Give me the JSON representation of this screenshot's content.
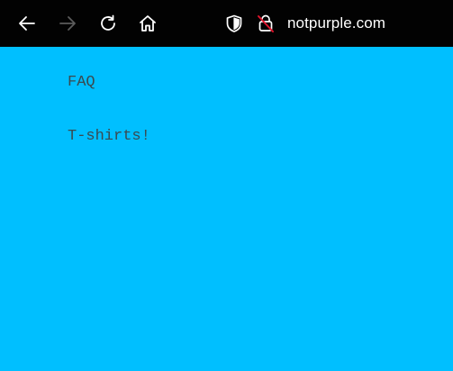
{
  "browser": {
    "address": "notpurple.com",
    "colors": {
      "toolbar": "#020202",
      "icon": "#ffffff",
      "icon_disabled": "#5c5c5c",
      "insecure_slash": "#e0142c"
    },
    "icons": [
      "back-arrow-icon",
      "forward-arrow-icon",
      "reload-icon",
      "home-icon",
      "shield-icon",
      "insecure-lock-icon"
    ]
  },
  "page": {
    "background": "#00bfff",
    "text_color": "#3a4a50",
    "links": [
      {
        "label": "FAQ"
      },
      {
        "label": "T-shirts!"
      }
    ]
  }
}
